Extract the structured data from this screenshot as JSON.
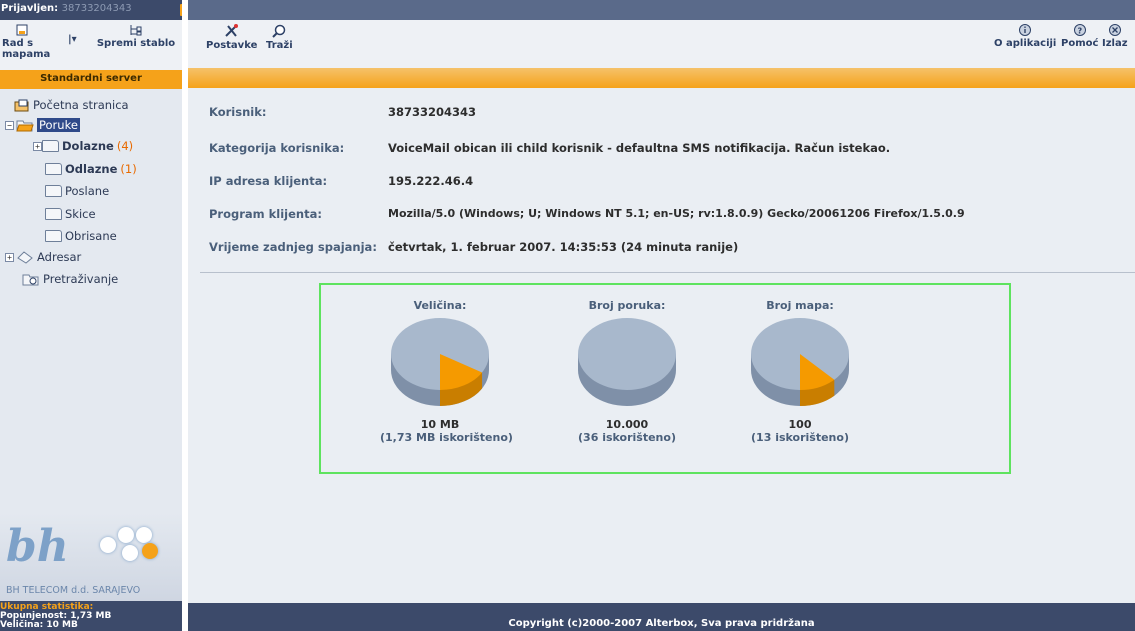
{
  "header": {
    "logged_in_label": "Prijavljen:",
    "user_number": "38733204343"
  },
  "left_toolbar": {
    "work_with_folders": "Rad s mapama",
    "save_tree": "Spremi stablo"
  },
  "server": "Standardni server",
  "tree": {
    "home": "Početna stranica",
    "messages": "Poruke",
    "inbox": "Dolazne",
    "inbox_count": "(4)",
    "outbox": "Odlazne",
    "outbox_count": "(1)",
    "sent": "Poslane",
    "drafts": "Skice",
    "deleted": "Obrisane",
    "address_book": "Adresar",
    "search": "Pretraživanje"
  },
  "logo": {
    "text": "bh",
    "company": "BH TELECOM d.d. SARAJEVO"
  },
  "stats": {
    "title": "Ukupna statistika:",
    "usage_label": "Popunjenost:",
    "usage": "1,73 MB",
    "size_label": "Veličina:",
    "size": "10 MB"
  },
  "toolbar": {
    "settings": "Postavke",
    "search": "Traži",
    "about": "O aplikaciji",
    "help": "Pomoć",
    "exit": "Izlaz"
  },
  "info": {
    "user_label": "Korisnik:",
    "user_value": "38733204343",
    "category_label": "Kategorija korisnika:",
    "category_value": "VoiceMail obican ili child korisnik - defaultna SMS notifikacija. Račun istekao.",
    "ip_label": "IP adresa klijenta:",
    "ip_value": "195.222.46.4",
    "program_label": "Program klijenta:",
    "program_value": "Mozilla/5.0 (Windows; U; Windows NT 5.1; en-US; rv:1.8.0.9) Gecko/20061206 Firefox/1.5.0.9",
    "last_login_label": "Vrijeme zadnjeg spajanja:",
    "last_login_value": "četvrtak, 1. februar 2007. 14:35:53 (24 minuta ranije)"
  },
  "charts": [
    {
      "title": "Veličina:",
      "total": "10 MB",
      "used": "(1,73 MB iskorišteno)",
      "fraction": 0.173,
      "colors": {
        "free": "#a8b8cc",
        "used": "#f59a00"
      }
    },
    {
      "title": "Broj poruka:",
      "total": "10.000",
      "used": "(36 iskorišteno)",
      "fraction": 0.0036,
      "colors": {
        "free": "#a8b8cc",
        "used": "#f59a00"
      }
    },
    {
      "title": "Broj mapa:",
      "total": "100",
      "used": "(13 iskorišteno)",
      "fraction": 0.13,
      "colors": {
        "free": "#a8b8cc",
        "used": "#f59a00"
      }
    }
  ],
  "footer": "Copyright (c)2000-2007 Alterbox, Sva prava pridržana"
}
